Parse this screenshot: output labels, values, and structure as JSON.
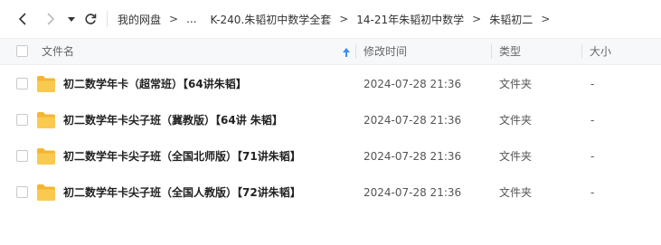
{
  "toolbar": {
    "back_icon": "chevron-left-icon",
    "forward_icon": "chevron-right-icon",
    "history_icon": "caret-down-icon",
    "refresh_icon": "refresh-icon"
  },
  "breadcrumb": {
    "items": [
      "我的网盘",
      "...",
      "K-240.朱韬初中数学全套",
      "14-21年朱韬初中数学",
      "朱韬初二"
    ],
    "separator": ">"
  },
  "table": {
    "columns": {
      "name": "文件名",
      "modified": "修改时间",
      "type": "类型",
      "size": "大小"
    },
    "rows": [
      {
        "name": "初二数学年卡（超常班）【64讲朱韬】",
        "modified": "2024-07-28 21:36",
        "type": "文件夹",
        "size": "-"
      },
      {
        "name": "初二数学年卡尖子班（冀教版）【64讲 朱韬】",
        "modified": "2024-07-28 21:36",
        "type": "文件夹",
        "size": "-"
      },
      {
        "name": "初二数学年卡尖子班（全国北师版）【71讲朱韬】",
        "modified": "2024-07-28 21:36",
        "type": "文件夹",
        "size": "-"
      },
      {
        "name": "初二数学年卡尖子班（全国人教版）【72讲朱韬】",
        "modified": "2024-07-28 21:36",
        "type": "文件夹",
        "size": "-"
      }
    ]
  },
  "colors": {
    "folder": "#f7c64a",
    "sort_arrow": "#3a8df5"
  }
}
